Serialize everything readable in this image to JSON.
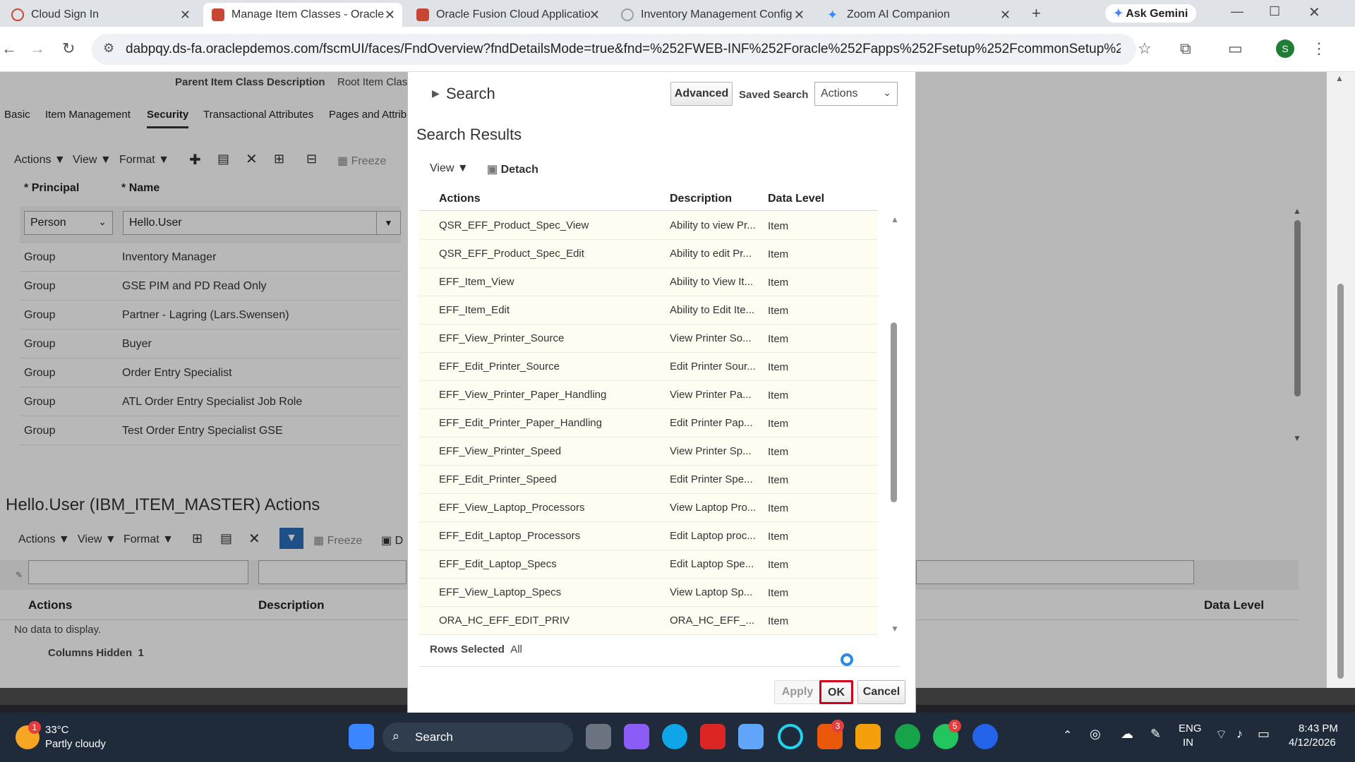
{
  "browser": {
    "tabs": [
      {
        "title": "Cloud Sign In",
        "color": "#c74634"
      },
      {
        "title": "Manage Item Classes - Oracle",
        "color": "#c74634"
      },
      {
        "title": "Oracle Fusion Cloud Applicatio",
        "color": "#c74634"
      },
      {
        "title": "Inventory Management Config",
        "color": "#9aa0a6"
      },
      {
        "title": "Zoom AI Companion",
        "color": "#2d8cff"
      }
    ],
    "ask_gemini": "Ask Gemini",
    "url": "dabpqy.ds-fa.oraclepdemos.com/fscmUI/faces/FndOverview?fndDetailsMode=true&fnd=%252FWEB-INF%252Foracle%252Fapps%252Fsetup%252FcommonSetup%252FuiUtil%252F...",
    "profile_initial": "S"
  },
  "page": {
    "header_fields": [
      "Parent Item Class Description",
      "Root Item Clas"
    ],
    "tabs": [
      "Basic",
      "Item Management",
      "Security",
      "Transactional Attributes",
      "Pages and Attrib"
    ],
    "active_tab": "Security",
    "toolbar": {
      "actions": "Actions",
      "view": "View",
      "format": "Format",
      "freeze": "Freeze"
    },
    "principal_header": "Principal",
    "name_header": "Name",
    "first_row": {
      "principal": "Person",
      "name": "Hello.User"
    },
    "rows": [
      {
        "principal": "Group",
        "name": "Inventory Manager"
      },
      {
        "principal": "Group",
        "name": "GSE PIM and PD Read Only"
      },
      {
        "principal": "Group",
        "name": "Partner - Lagring (Lars.Swensen)"
      },
      {
        "principal": "Group",
        "name": "Buyer"
      },
      {
        "principal": "Group",
        "name": "Order Entry Specialist"
      },
      {
        "principal": "Group",
        "name": "ATL Order Entry Specialist Job Role"
      },
      {
        "principal": "Group",
        "name": "Test Order Entry Specialist GSE"
      }
    ],
    "section_title": "Hello.User (IBM_ITEM_MASTER) Actions",
    "toolbar2": {
      "actions": "Actions",
      "view": "View",
      "format": "Format",
      "freeze": "Freeze",
      "detach_initial": "D"
    },
    "lower_headers": {
      "actions": "Actions",
      "description": "Description",
      "data_level": "Data Level"
    },
    "no_data": "No data to display.",
    "columns_hidden": "Columns Hidden",
    "columns_hidden_count": "1"
  },
  "dialog": {
    "search_label": "Search",
    "advanced_button": "Advanced",
    "saved_search_label": "Saved Search",
    "saved_search_value": "Actions",
    "results_title": "Search Results",
    "view_label": "View",
    "detach_label": "Detach",
    "columns": {
      "actions": "Actions",
      "description": "Description",
      "data_level": "Data Level"
    },
    "rows": [
      {
        "action": "QSR_EFF_Product_Spec_View",
        "description": "Ability to view Pr...",
        "level": "Item"
      },
      {
        "action": "QSR_EFF_Product_Spec_Edit",
        "description": "Ability to edit Pr...",
        "level": "Item"
      },
      {
        "action": "EFF_Item_View",
        "description": "Ability to View It...",
        "level": "Item"
      },
      {
        "action": "EFF_Item_Edit",
        "description": "Ability to Edit Ite...",
        "level": "Item"
      },
      {
        "action": "EFF_View_Printer_Source",
        "description": "View Printer So...",
        "level": "Item"
      },
      {
        "action": "EFF_Edit_Printer_Source",
        "description": "Edit Printer Sour...",
        "level": "Item"
      },
      {
        "action": "EFF_View_Printer_Paper_Handling",
        "description": "View Printer Pa...",
        "level": "Item"
      },
      {
        "action": "EFF_Edit_Printer_Paper_Handling",
        "description": "Edit Printer Pap...",
        "level": "Item"
      },
      {
        "action": "EFF_View_Printer_Speed",
        "description": "View Printer Sp...",
        "level": "Item"
      },
      {
        "action": "EFF_Edit_Printer_Speed",
        "description": "Edit Printer Spe...",
        "level": "Item"
      },
      {
        "action": "EFF_View_Laptop_Processors",
        "description": "View Laptop Pro...",
        "level": "Item"
      },
      {
        "action": "EFF_Edit_Laptop_Processors",
        "description": "Edit Laptop proc...",
        "level": "Item"
      },
      {
        "action": "EFF_Edit_Laptop_Specs",
        "description": "Edit Laptop Spe...",
        "level": "Item"
      },
      {
        "action": "EFF_View_Laptop_Specs",
        "description": "View Laptop Sp...",
        "level": "Item"
      },
      {
        "action": "ORA_HC_EFF_EDIT_PRIV",
        "description": "ORA_HC_EFF_...",
        "level": "Item"
      }
    ],
    "rows_selected_label": "Rows Selected",
    "rows_selected_value": "All",
    "apply_button": "Apply",
    "ok_button": "OK",
    "cancel_button": "Cancel",
    "highlight_color": "#d0021b"
  },
  "taskbar": {
    "weather_temp": "33°C",
    "weather_desc": "Partly cloudy",
    "weather_badge": "1",
    "search_placeholder": "Search",
    "badge_l": "3",
    "badge_whatsapp": "5",
    "lang": "ENG",
    "region": "IN",
    "time": "8:43 PM",
    "date": "4/12/2026"
  }
}
